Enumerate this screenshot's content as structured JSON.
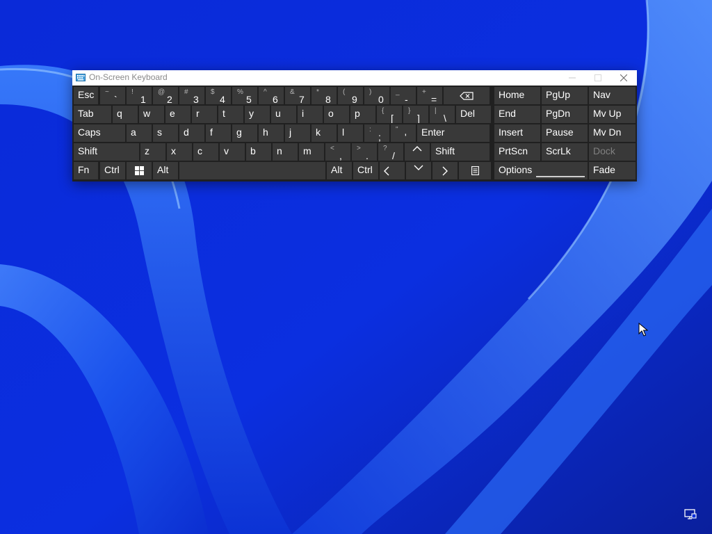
{
  "window": {
    "title": "On-Screen Keyboard",
    "title_icon": "keyboard-icon",
    "controls": [
      "minimize-icon",
      "maximize-icon",
      "close-icon"
    ]
  },
  "keyboard": {
    "rows": [
      [
        {
          "name": "key-esc",
          "label": "Esc"
        },
        {
          "name": "key-backtick",
          "primary": "`",
          "secondary": "~"
        },
        {
          "name": "key-1",
          "primary": "1",
          "secondary": "!"
        },
        {
          "name": "key-2",
          "primary": "2",
          "secondary": "@"
        },
        {
          "name": "key-3",
          "primary": "3",
          "secondary": "#"
        },
        {
          "name": "key-4",
          "primary": "4",
          "secondary": "$"
        },
        {
          "name": "key-5",
          "primary": "5",
          "secondary": "%"
        },
        {
          "name": "key-6",
          "primary": "6",
          "secondary": "^"
        },
        {
          "name": "key-7",
          "primary": "7",
          "secondary": "&"
        },
        {
          "name": "key-8",
          "primary": "8",
          "secondary": "*"
        },
        {
          "name": "key-9",
          "primary": "9",
          "secondary": "("
        },
        {
          "name": "key-0",
          "primary": "0",
          "secondary": ")"
        },
        {
          "name": "key-minus",
          "primary": "-",
          "secondary": "_"
        },
        {
          "name": "key-equals",
          "primary": "=",
          "secondary": "+"
        },
        {
          "name": "key-backspace",
          "icon": "backspace-icon"
        },
        {
          "name": "key-home",
          "label": "Home"
        },
        {
          "name": "key-pgup",
          "label": "PgUp"
        },
        {
          "name": "key-nav",
          "label": "Nav"
        }
      ],
      [
        {
          "name": "key-tab",
          "label": "Tab"
        },
        {
          "name": "key-q",
          "label": "q"
        },
        {
          "name": "key-w",
          "label": "w"
        },
        {
          "name": "key-e",
          "label": "e"
        },
        {
          "name": "key-r",
          "label": "r"
        },
        {
          "name": "key-t",
          "label": "t"
        },
        {
          "name": "key-y",
          "label": "y"
        },
        {
          "name": "key-u",
          "label": "u"
        },
        {
          "name": "key-i",
          "label": "i"
        },
        {
          "name": "key-o",
          "label": "o"
        },
        {
          "name": "key-p",
          "label": "p"
        },
        {
          "name": "key-lbracket",
          "primary": "[",
          "secondary": "{"
        },
        {
          "name": "key-rbracket",
          "primary": "]",
          "secondary": "}"
        },
        {
          "name": "key-backslash",
          "primary": "\\",
          "secondary": "|"
        },
        {
          "name": "key-del",
          "label": "Del"
        },
        {
          "name": "key-end",
          "label": "End"
        },
        {
          "name": "key-pgdn",
          "label": "PgDn"
        },
        {
          "name": "key-mvup",
          "label": "Mv Up"
        }
      ],
      [
        {
          "name": "key-caps",
          "label": "Caps"
        },
        {
          "name": "key-a",
          "label": "a"
        },
        {
          "name": "key-s",
          "label": "s"
        },
        {
          "name": "key-d",
          "label": "d"
        },
        {
          "name": "key-f",
          "label": "f"
        },
        {
          "name": "key-g",
          "label": "g"
        },
        {
          "name": "key-h",
          "label": "h"
        },
        {
          "name": "key-j",
          "label": "j"
        },
        {
          "name": "key-k",
          "label": "k"
        },
        {
          "name": "key-l",
          "label": "l"
        },
        {
          "name": "key-semicolon",
          "primary": ";",
          "secondary": ":"
        },
        {
          "name": "key-quote",
          "primary": "'",
          "secondary": "\""
        },
        {
          "name": "key-enter",
          "label": "Enter"
        },
        {
          "name": "key-insert",
          "label": "Insert"
        },
        {
          "name": "key-pause",
          "label": "Pause"
        },
        {
          "name": "key-mvdn",
          "label": "Mv Dn"
        }
      ],
      [
        {
          "name": "key-shift-left",
          "label": "Shift"
        },
        {
          "name": "key-z",
          "label": "z"
        },
        {
          "name": "key-x",
          "label": "x"
        },
        {
          "name": "key-c",
          "label": "c"
        },
        {
          "name": "key-v",
          "label": "v"
        },
        {
          "name": "key-b",
          "label": "b"
        },
        {
          "name": "key-n",
          "label": "n"
        },
        {
          "name": "key-m",
          "label": "m"
        },
        {
          "name": "key-comma",
          "primary": ",",
          "secondary": "<"
        },
        {
          "name": "key-period",
          "primary": ".",
          "secondary": ">"
        },
        {
          "name": "key-slash",
          "primary": "/",
          "secondary": "?"
        },
        {
          "name": "key-arrow-up",
          "icon": "chevron-up-icon"
        },
        {
          "name": "key-shift-right",
          "label": "Shift"
        },
        {
          "name": "key-prtscn",
          "label": "PrtScn"
        },
        {
          "name": "key-scrlk",
          "label": "ScrLk"
        },
        {
          "name": "key-dock",
          "label": "Dock",
          "disabled": true
        }
      ],
      [
        {
          "name": "key-fn",
          "label": "Fn"
        },
        {
          "name": "key-ctrl-left",
          "label": "Ctrl"
        },
        {
          "name": "key-win",
          "icon": "windows-logo-icon"
        },
        {
          "name": "key-alt-left",
          "label": "Alt"
        },
        {
          "name": "key-space",
          "label": ""
        },
        {
          "name": "key-alt-right",
          "label": "Alt"
        },
        {
          "name": "key-ctrl-right",
          "label": "Ctrl"
        },
        {
          "name": "key-arrow-left",
          "icon": "chevron-left-icon"
        },
        {
          "name": "key-arrow-down",
          "icon": "chevron-down-icon"
        },
        {
          "name": "key-arrow-right",
          "icon": "chevron-right-icon"
        },
        {
          "name": "key-menu",
          "icon": "menu-key-icon"
        },
        {
          "name": "key-options",
          "label": "Options"
        },
        {
          "name": "key-fade",
          "label": "Fade"
        }
      ]
    ]
  },
  "taskbar": {
    "tray_icon": "remote-display-icon"
  },
  "colors": {
    "key_bg": "#393939",
    "panel_bg": "#202020",
    "key_text": "#ffffff",
    "disabled_text": "#808080",
    "wallpaper": "#0b2fd9"
  }
}
